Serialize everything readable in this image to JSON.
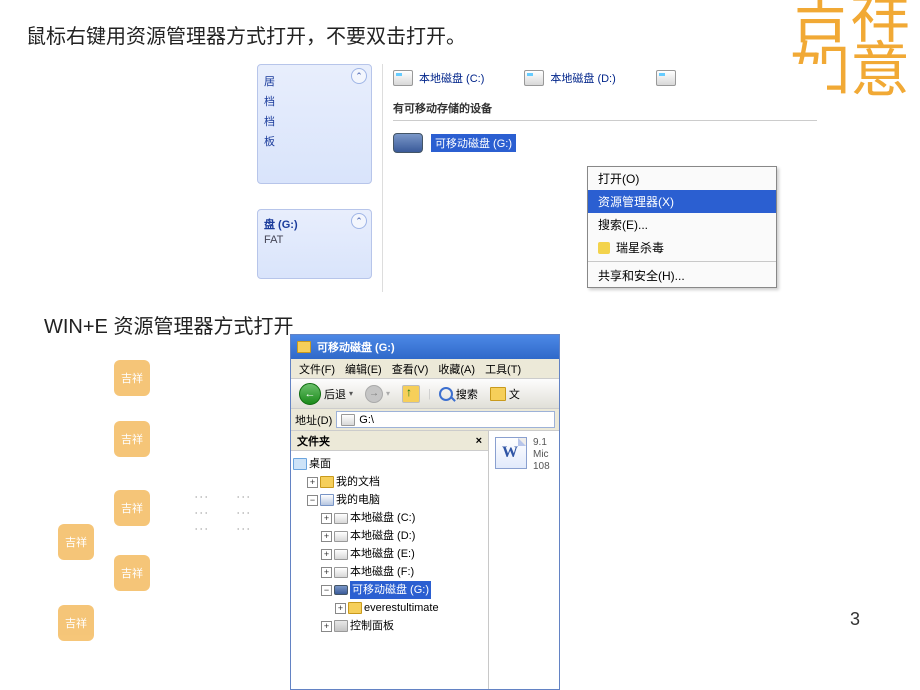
{
  "text": {
    "instruction_top": "鼠标右键用资源管理器方式打开，不要双击打开。",
    "instruction_mid": "WIN+E 资源管理器方式打开",
    "page_number": "3"
  },
  "fig1": {
    "side_panel_lines": [
      "居",
      "档",
      "档",
      "板"
    ],
    "details": {
      "title": "盘 (G:)",
      "fs": "FAT"
    },
    "disk_c": "本地磁盘 (C:)",
    "disk_d": "本地磁盘 (D:)",
    "section": "有可移动存储的设备",
    "removable_label": "可移动磁盘 (G:)",
    "menu": {
      "open": "打开(O)",
      "explorer": "资源管理器(X)",
      "search": "搜索(E)...",
      "rising": "瑞星杀毒",
      "share": "共享和安全(H)..."
    }
  },
  "fig2": {
    "title": "可移动磁盘 (G:)",
    "menu": {
      "file": "文件(F)",
      "edit": "编辑(E)",
      "view": "查看(V)",
      "fav": "收藏(A)",
      "tools": "工具(T)"
    },
    "toolbar": {
      "back": "后退",
      "search": "搜索",
      "folders": "文"
    },
    "address_label": "地址(D)",
    "address_value": "G:\\",
    "tree_header": "文件夹",
    "tree": {
      "desktop": "桌面",
      "mydocs": "我的文档",
      "mypc": "我的电脑",
      "c": "本地磁盘 (C:)",
      "d": "本地磁盘 (D:)",
      "e": "本地磁盘 (E:)",
      "f": "本地磁盘 (F:)",
      "g": "可移动磁盘 (G:)",
      "everest": "everestultimate",
      "cp": "控制面板"
    },
    "file": {
      "line1": "9.1",
      "line2": "Mic",
      "line3": "108"
    }
  },
  "decor": "吉祥如意"
}
